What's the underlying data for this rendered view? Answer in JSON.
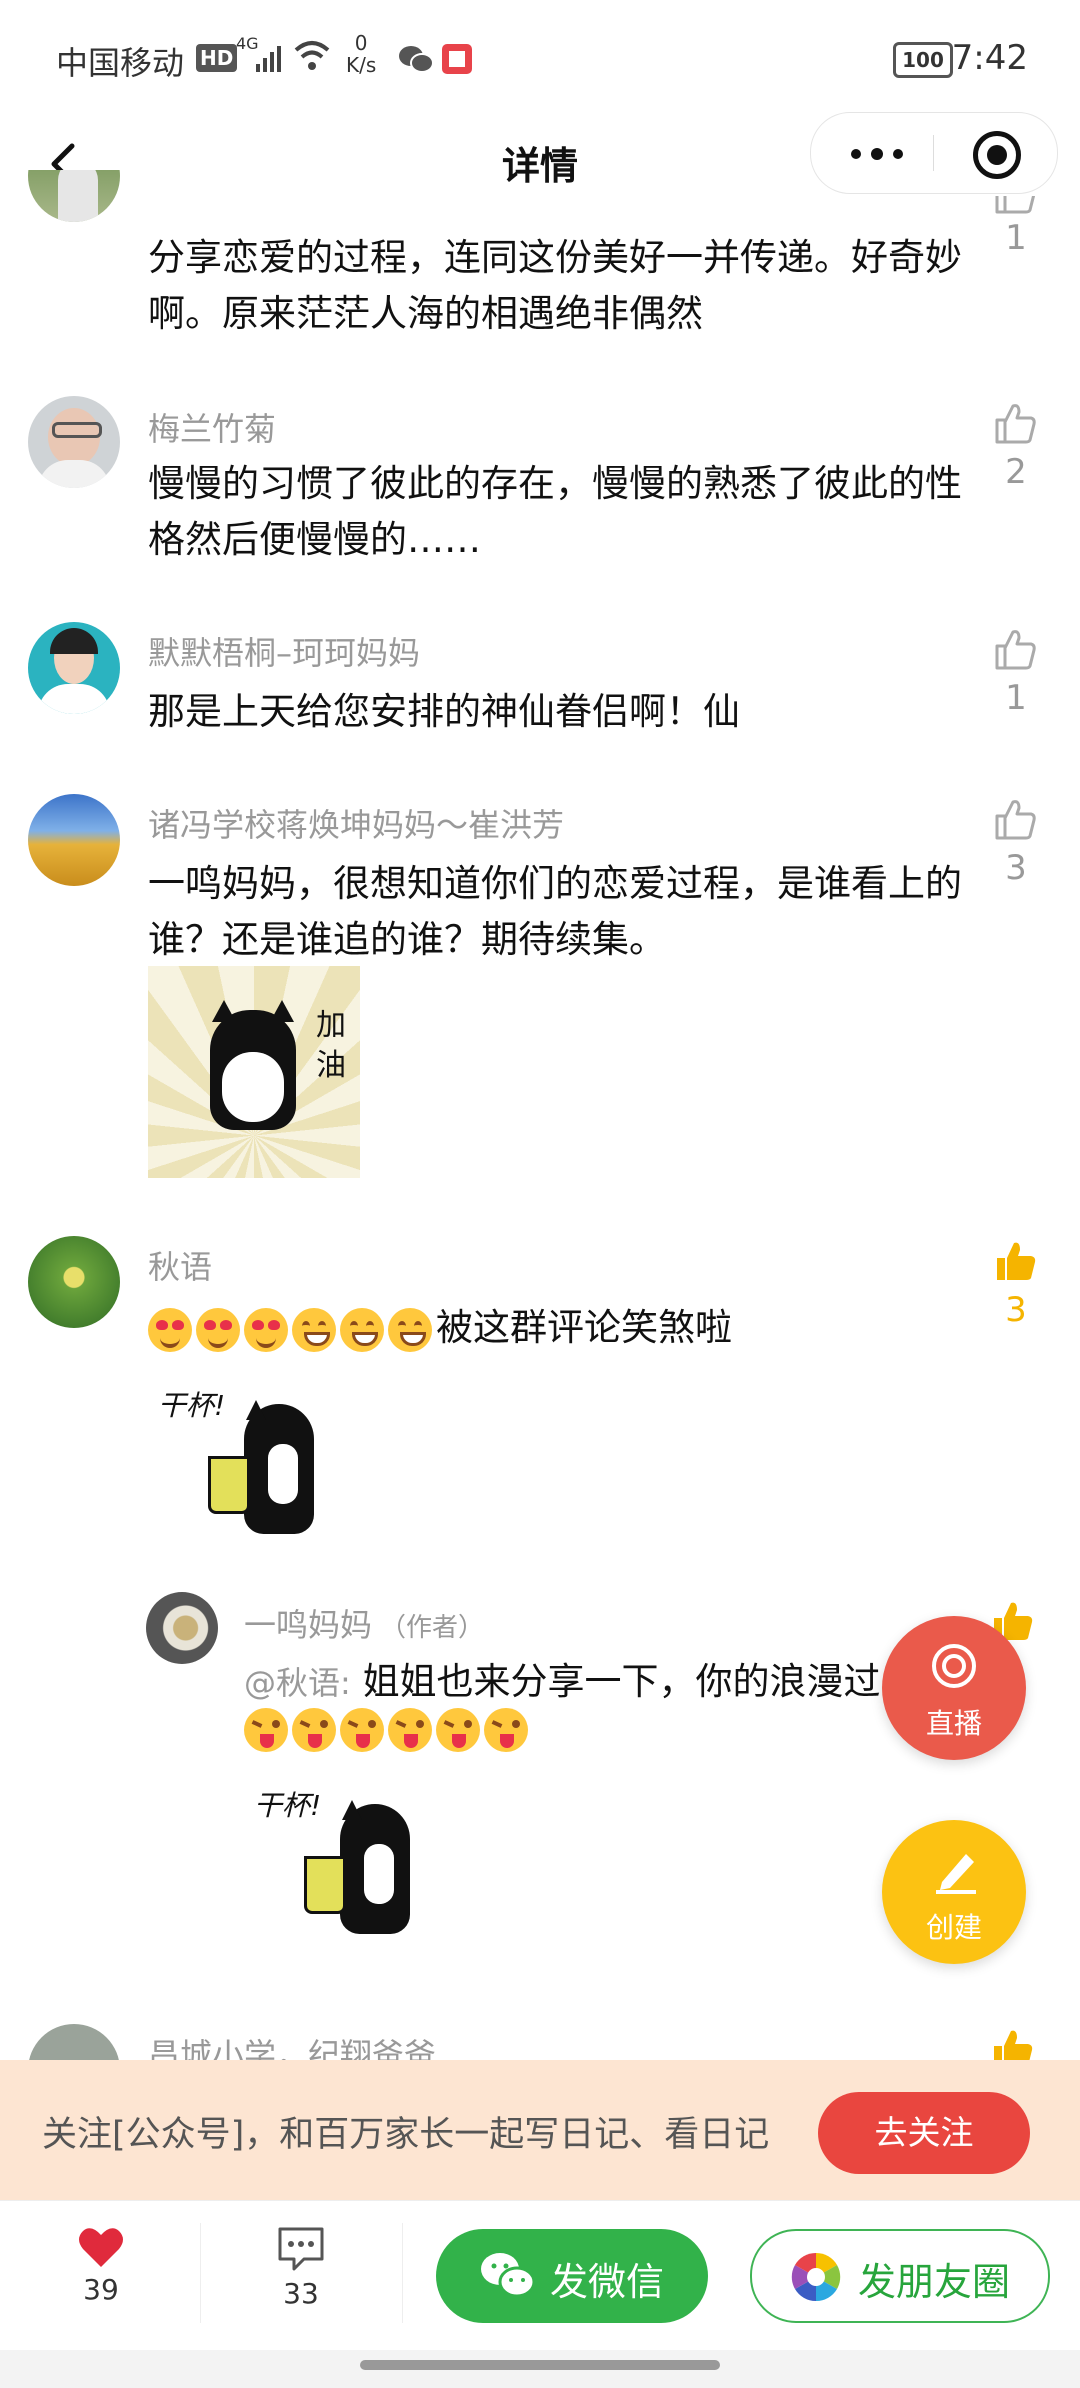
{
  "status_bar": {
    "carrier": "中国移动",
    "hd": "HD",
    "network": "4G",
    "speed_value": "0",
    "speed_unit": "K/s",
    "battery": "100",
    "time": "7:42"
  },
  "nav": {
    "title": "详情"
  },
  "comments": [
    {
      "name": "",
      "text": "分享恋爱的过程，连同这份美好一并传递。好奇妙啊。原来茫茫人海的相遇绝非偶然",
      "likes": "1",
      "liked": false
    },
    {
      "name": "梅兰竹菊",
      "text": "慢慢的习惯了彼此的存在，慢慢的熟悉了彼此的性格然后便慢慢的……",
      "likes": "2",
      "liked": false
    },
    {
      "name": "默默梧桐–珂珂妈妈",
      "text": "那是上天给您安排的神仙眷侣啊！仙",
      "likes": "1",
      "liked": false
    },
    {
      "name": "诸冯学校蒋焕坤妈妈～崔洪芳",
      "text": "一鸣妈妈，很想知道你们的恋爱过程，是谁看上的谁？还是谁追的谁？期待续集。",
      "likes": "3",
      "liked": false,
      "sticker_text": "加油"
    },
    {
      "name": "秋语",
      "text": "被这群评论笑煞啦",
      "likes": "3",
      "liked": true,
      "emojis": [
        "heart-eyes",
        "heart-eyes",
        "heart-eyes",
        "grin",
        "grin",
        "grin"
      ],
      "sticker_text": "干杯!"
    }
  ],
  "reply": {
    "name": "一鸣妈妈",
    "tag": "（作者）",
    "mention": "@秋语:",
    "text": "姐姐也来分享一下，你的浪漫过",
    "emojis": [
      "tongue",
      "tongue",
      "tongue",
      "tongue",
      "tongue",
      "tongue"
    ],
    "sticker_text": "干杯!"
  },
  "next_comment_name": "昌城小学，纪翔爸爸",
  "fab": {
    "live_label": "直播",
    "create_label": "创建",
    "live_color": "#ea5a4b",
    "create_color": "#fcc212"
  },
  "banner": {
    "text": "关注[公众号]，和百万家长一起写日记、看日记",
    "button": "去关注"
  },
  "bottom_bar": {
    "likes": "39",
    "comments": "33",
    "wechat_label": "发微信",
    "moments_label": "发朋友圈"
  }
}
